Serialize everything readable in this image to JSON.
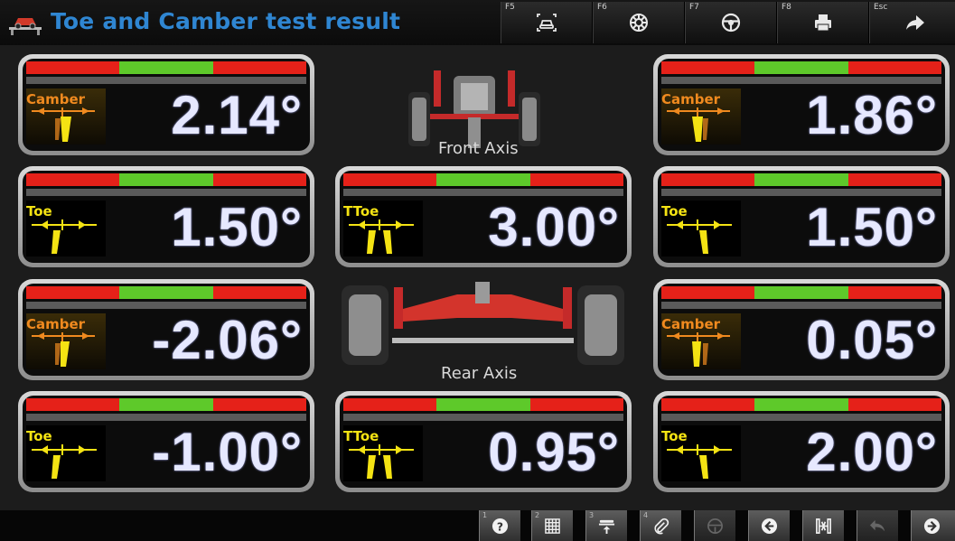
{
  "header": {
    "title": "Toe and Camber test result"
  },
  "function_keys": [
    {
      "key": "F5",
      "icon": "vehicle-scan-icon"
    },
    {
      "key": "F6",
      "icon": "wheel-icon"
    },
    {
      "key": "F7",
      "icon": "steering-wheel-icon"
    },
    {
      "key": "F8",
      "icon": "printer-icon"
    },
    {
      "key": "Esc",
      "icon": "forward-arrow-icon"
    }
  ],
  "front": {
    "left_camber": {
      "label": "Camber",
      "value": "2.14°"
    },
    "right_camber": {
      "label": "Camber",
      "value": "1.86°"
    },
    "left_toe": {
      "label": "Toe",
      "value": "1.50°"
    },
    "total_toe": {
      "label": "TToe",
      "value": "3.00°"
    },
    "right_toe": {
      "label": "Toe",
      "value": "1.50°"
    },
    "axis_label": "Front Axis"
  },
  "rear": {
    "left_camber": {
      "label": "Camber",
      "value": "-2.06°"
    },
    "right_camber": {
      "label": "Camber",
      "value": "0.05°"
    },
    "left_toe": {
      "label": "Toe",
      "value": "-1.00°"
    },
    "total_toe": {
      "label": "TToe",
      "value": "0.95°"
    },
    "right_toe": {
      "label": "Toe",
      "value": "2.00°"
    },
    "axis_label": "Rear Axis"
  },
  "bottom_buttons": [
    {
      "num": "1",
      "icon": "help-icon"
    },
    {
      "num": "2",
      "icon": "grid-icon"
    },
    {
      "num": "3",
      "icon": "lift-icon"
    },
    {
      "num": "4",
      "icon": "attachment-icon"
    },
    {
      "num": "",
      "icon": "steering-disabled-icon"
    },
    {
      "num": "",
      "icon": "back-arrow-icon"
    },
    {
      "num": "",
      "icon": "axle-adjust-icon"
    },
    {
      "num": "",
      "icon": "undo-icon"
    },
    {
      "num": "",
      "icon": "next-arrow-icon"
    }
  ],
  "colors": {
    "title": "#2f86d2",
    "red_zone": "#e52119",
    "green_zone": "#5ec92a",
    "camber_label": "#f08a1f",
    "toe_label": "#f4e313",
    "value_text": "#e6e8ff"
  }
}
